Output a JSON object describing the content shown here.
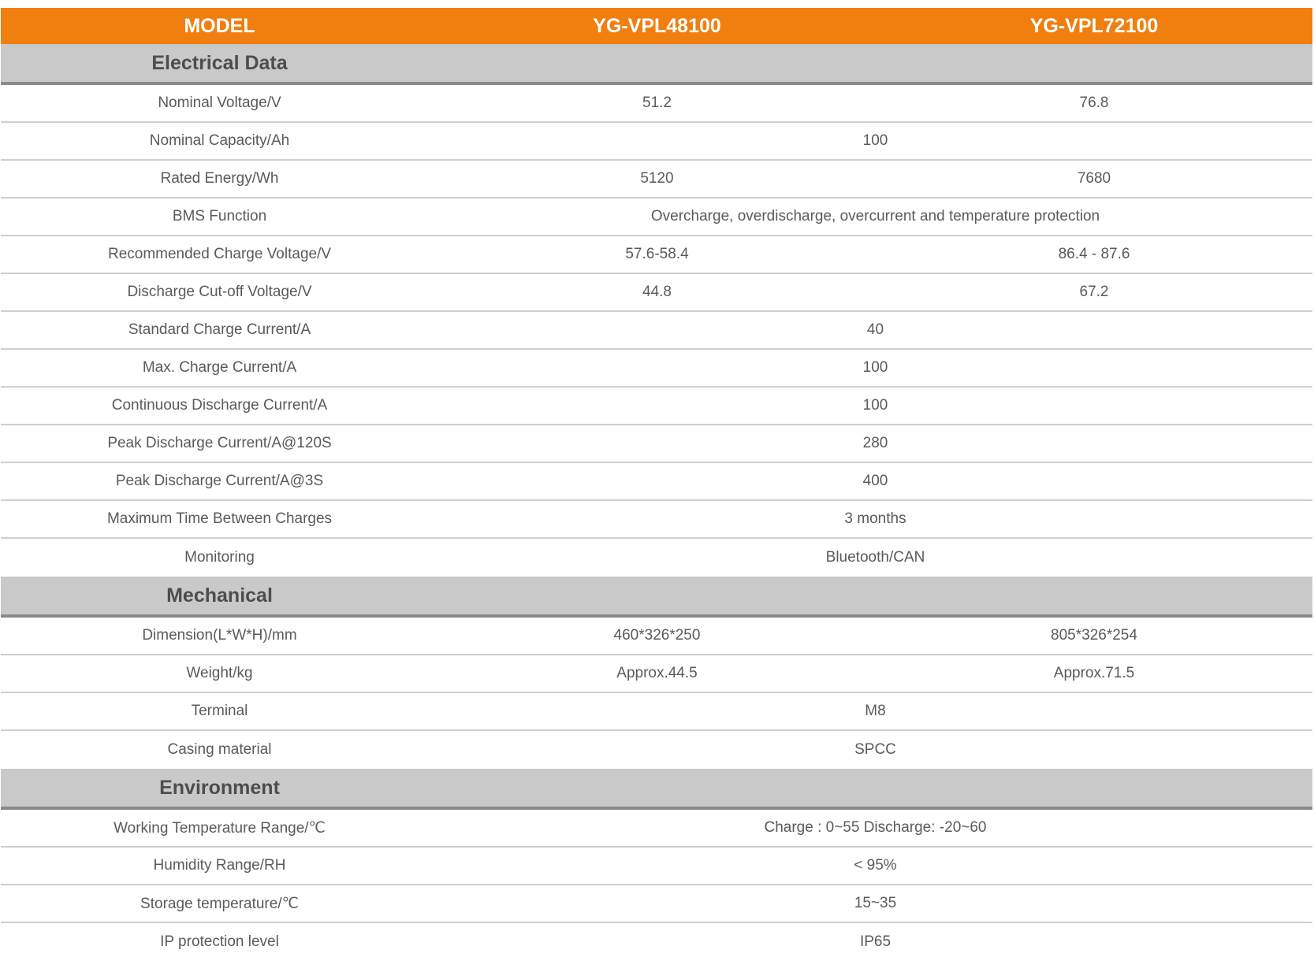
{
  "header": {
    "model": "MODEL",
    "col1": "YG-VPL48100",
    "col2": "YG-VPL72100"
  },
  "sections": [
    {
      "title": "Electrical Data",
      "rows": [
        {
          "label": "Nominal Voltage/V",
          "values": [
            "51.2",
            "76.8"
          ]
        },
        {
          "label": "Nominal Capacity/Ah",
          "values": [
            "100"
          ]
        },
        {
          "label": "Rated Energy/Wh",
          "values": [
            "5120",
            "7680"
          ]
        },
        {
          "label": "BMS Function",
          "values": [
            "Overcharge, overdischarge, overcurrent and temperature protection"
          ]
        },
        {
          "label": "Recommended Charge Voltage/V",
          "values": [
            "57.6-58.4",
            "86.4 - 87.6"
          ]
        },
        {
          "label": "Discharge Cut-off Voltage/V",
          "values": [
            "44.8",
            "67.2"
          ]
        },
        {
          "label": "Standard Charge Current/A",
          "values": [
            "40"
          ]
        },
        {
          "label": "Max. Charge Current/A",
          "values": [
            "100"
          ]
        },
        {
          "label": "Continuous Discharge Current/A",
          "values": [
            "100"
          ]
        },
        {
          "label": "Peak Discharge Current/A@120S",
          "values": [
            "280"
          ]
        },
        {
          "label": "Peak Discharge Current/A@3S",
          "values": [
            "400"
          ]
        },
        {
          "label": "Maximum Time Between Charges",
          "values": [
            "3 months"
          ]
        },
        {
          "label": "Monitoring",
          "values": [
            "Bluetooth/CAN"
          ]
        }
      ]
    },
    {
      "title": "Mechanical",
      "rows": [
        {
          "label": "Dimension(L*W*H)/mm",
          "values": [
            "460*326*250",
            "805*326*254"
          ]
        },
        {
          "label": "Weight/kg",
          "values": [
            "Approx.44.5",
            "Approx.71.5"
          ]
        },
        {
          "label": "Terminal",
          "values": [
            "M8"
          ]
        },
        {
          "label": "Casing material",
          "values": [
            "SPCC"
          ]
        }
      ]
    },
    {
      "title": "Environment",
      "rows": [
        {
          "label": "Working Temperature Range/℃",
          "values": [
            "Charge : 0~55 Discharge: -20~60"
          ]
        },
        {
          "label": "Humidity Range/RH",
          "values": [
            "< 95%"
          ]
        },
        {
          "label": "Storage temperature/℃",
          "values": [
            "15~35"
          ]
        },
        {
          "label": "IP protection level",
          "values": [
            "IP65"
          ]
        }
      ]
    }
  ]
}
